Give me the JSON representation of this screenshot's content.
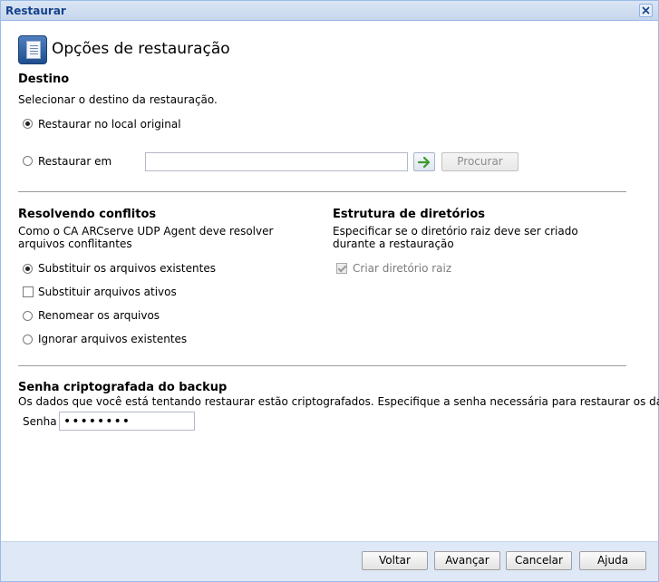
{
  "window": {
    "title": "Restaurar"
  },
  "header": {
    "title": "Opções de restauração"
  },
  "destination": {
    "title": "Destino",
    "description": "Selecionar o destino da restauração.",
    "option_original": "Restaurar no local original",
    "option_restore_to": "Restaurar em",
    "path_value": "",
    "browse_label": "Procurar",
    "selected": "original"
  },
  "conflicts": {
    "title": "Resolvendo conflitos",
    "description": "Como o CA ARCserve UDP Agent deve resolver arquivos conflitantes",
    "option_overwrite": "Substituir os arquivos existentes",
    "option_replace_active": "Substituir arquivos ativos",
    "option_rename": "Renomear os arquivos",
    "option_skip": "Ignorar arquivos existentes"
  },
  "directory": {
    "title": "Estrutura de diretórios",
    "description": "Especificar se o diretório raiz deve ser criado durante a restauração",
    "option_create_root": "Criar diretório raiz"
  },
  "encryption": {
    "title": "Senha criptografada do backup",
    "description": "Os dados que você está tentando restaurar estão criptografados. Especifique a senha necessária para restaurar os dados.",
    "password_label": "Senha",
    "password_value": "********"
  },
  "footer": {
    "back_label": "Voltar",
    "next_label": "Avançar",
    "cancel_label": "Cancelar",
    "help_label": "Ajuda"
  },
  "icons": {
    "close": "close-icon",
    "go": "arrow-right-icon",
    "header": "restore-document-icon"
  },
  "colors": {
    "title_text": "#15428b",
    "footer_bg": "#dfe8f6",
    "arrow": "#3c9b2d"
  }
}
